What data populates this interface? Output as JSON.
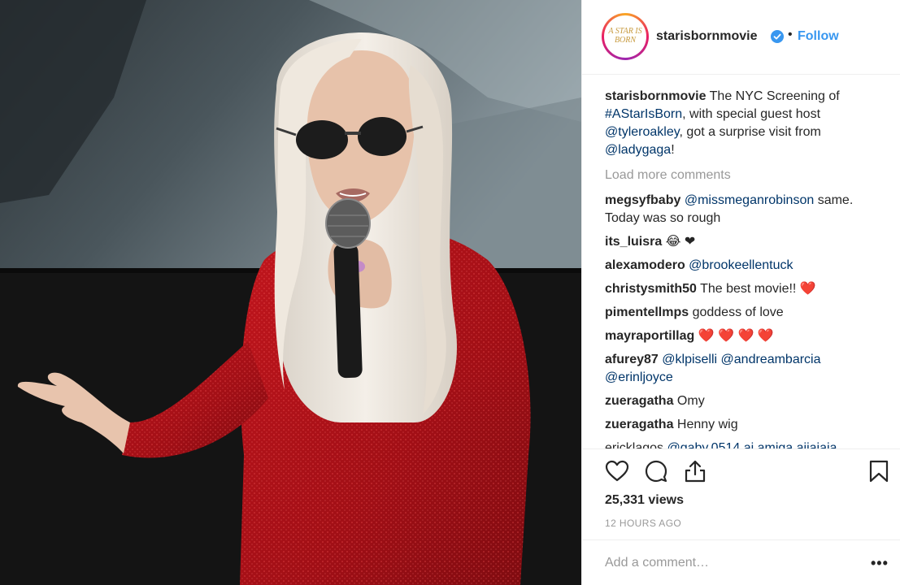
{
  "post": {
    "username": "starisbornmovie",
    "follow_label": "Follow",
    "separator": "•",
    "avatar_text": "A STAR IS BORN"
  },
  "caption": {
    "username": "starisbornmovie",
    "text_1": " The NYC Screening of ",
    "hashtag": "#AStarIsBorn",
    "text_2": ", with special guest host ",
    "mention_1": "@tyleroakley",
    "text_3": ", got a surprise visit from ",
    "mention_2": "@ladygaga",
    "text_4": "!"
  },
  "load_more_label": "Load more comments",
  "comments": [
    {
      "user": "megsyfbaby",
      "mention": "@missmeganrobinson",
      "text": " same. Today was so rough"
    },
    {
      "user": "its_luisra",
      "text": " 😂 ❤"
    },
    {
      "user": "alexamodero",
      "mention": "@brookeellentuck",
      "text": ""
    },
    {
      "user": "christysmith50",
      "text": " The best movie!! ",
      "emoji": "❤️"
    },
    {
      "user": "pimentellmps",
      "text": " goddess of love"
    },
    {
      "user": "mayraportillag",
      "emoji": "❤️ ❤️ ❤️ ❤️"
    },
    {
      "user": "afurey87",
      "mention": "@klpiselli @andreambarcia @erinljoyce",
      "text": ""
    },
    {
      "user": "zueragatha",
      "text": " Omy"
    },
    {
      "user": "zueragatha",
      "text": " Henny wig"
    },
    {
      "user": "ericklagos",
      "text": " @gaby.0514 ai amiga aiiaiaia"
    }
  ],
  "stats": {
    "views": "25,331 views",
    "time": "12 HOURS AGO"
  },
  "add_comment": {
    "placeholder": "Add a comment…",
    "more": "•••"
  },
  "icons": [
    "heart-icon",
    "comment-icon",
    "share-icon",
    "bookmark-icon",
    "verified-badge-icon"
  ],
  "colors": {
    "link": "#3897f0",
    "mention": "#003569",
    "muted": "#999999",
    "heart": "#ed4956",
    "dress": "#b3141a"
  }
}
